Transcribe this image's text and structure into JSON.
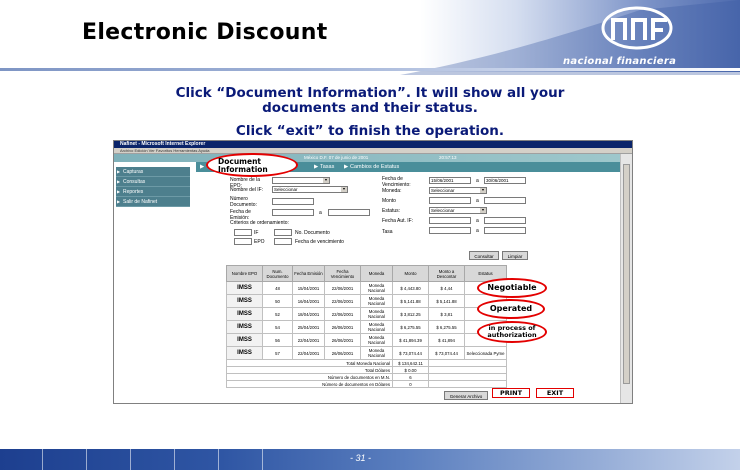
{
  "slide": {
    "title": "Electronic Discount",
    "logo_text": "nacional financiera",
    "instruction_1_line_1": "Click “Document Information”. It will show all your",
    "instruction_1_line_2": "documents and their status.",
    "instruction_2": "Click “exit” to finish the operation.",
    "page_number": "- 31 -"
  },
  "browser": {
    "window_title": "Nafinet - Microsoft Internet Explorer",
    "menu_bar": "Archivo  Edición  Ver  Favoritos  Herramientas  Ayuda",
    "header_date": "México D.F. 07 de junio de 2001",
    "header_time": "20:57:13",
    "nav_tab_tasas": "Tasas",
    "nav_tab_cambios": "Cambios de Estatus"
  },
  "left_menu": {
    "items": [
      "Capturas",
      "Consultas",
      "Reportes",
      "Salir de Nafinet"
    ]
  },
  "form": {
    "epo_label": "Nombre de la EPO:",
    "if_label": "Nombre del IF:",
    "if_value": "Seleccionar",
    "num_doc_label": "Número Documento:",
    "fecha_emision_label": "Fecha de Emisión:",
    "a_label": "a",
    "criterios_label": "Criterios de ordenamiento:",
    "if_sort_label": "IF",
    "num_doc_sort_label": "No. Documento",
    "epo_sort_label": "EPO",
    "fecha_venc_sort_label": "Fecha de vencimiento",
    "fecha_venc_label": "Fecha de Vencimiento:",
    "fecha_venc_from": "15/06/2001",
    "fecha_venc_to": "30/06/2001",
    "moneda_label": "Moneda:",
    "moneda_value": "Seleccionar",
    "monto_label": "Monto",
    "estatus_label": "Estatus:",
    "estatus_value": "Seleccionar",
    "fecha_aut_label": "Fecha Aut. IF:",
    "tasa_label": "Tasa",
    "consultar_label": "Consultar",
    "limpiar_label": "Limpiar"
  },
  "table": {
    "headers": [
      "Nombre EPO",
      "Num. Documento",
      "Fecha Emisión",
      "Fecha Vencimiento",
      "Moneda",
      "Monto",
      "Monto a Descontar",
      "Estatus"
    ],
    "rows": [
      {
        "epo": "IMSS",
        "num": "48",
        "emision": "15/04/2001",
        "venc": "22/06/2001",
        "moneda": "Moneda Nacional",
        "monto": "$ 4,443.80",
        "descontar": "$ 4,44",
        "estatus": ""
      },
      {
        "epo": "IMSS",
        "num": "50",
        "emision": "16/04/2001",
        "venc": "22/06/2001",
        "moneda": "Moneda Nacional",
        "monto": "$ 5,141.88",
        "descontar": "$ 5,141.88",
        "estatus": ""
      },
      {
        "epo": "IMSS",
        "num": "52",
        "emision": "18/04/2001",
        "venc": "22/06/2001",
        "moneda": "Moneda Nacional",
        "monto": "$ 3,812.25",
        "descontar": "$ 3,81",
        "estatus": ""
      },
      {
        "epo": "IMSS",
        "num": "54",
        "emision": "25/04/2001",
        "venc": "26/06/2001",
        "moneda": "Moneda Nacional",
        "monto": "$ 6,275.55",
        "descontar": "$ 6,275.55",
        "estatus": ""
      },
      {
        "epo": "IMSS",
        "num": "56",
        "emision": "22/04/2001",
        "venc": "26/06/2001",
        "moneda": "Moneda Nacional",
        "monto": "$ 41,894.39",
        "descontar": "$ 41,894",
        "estatus": ""
      },
      {
        "epo": "IMSS",
        "num": "57",
        "emision": "22/04/2001",
        "venc": "26/06/2001",
        "moneda": "Moneda Nacional",
        "monto": "$ 73,074.44",
        "descontar": "$ 73,074.44",
        "estatus": "Seleccionada Pyme"
      }
    ],
    "totals": [
      {
        "label": "Total Moneda Nacional",
        "value": "$ 134,642.11"
      },
      {
        "label": "Total Dólares",
        "value": "$ 0.00"
      },
      {
        "label": "Número de documentos en M.N.",
        "value": "6"
      },
      {
        "label": "Número de documentos en Dólares",
        "value": "0"
      }
    ]
  },
  "callouts": {
    "document_information": "Document Information",
    "negotiable": "Negotiable",
    "operated": "Operated",
    "in_process": "in process of authorization"
  },
  "buttons": {
    "generar": "Generar Archivo",
    "print": "PRINT",
    "exit": "EXIT"
  },
  "colors": {
    "instruction_text": "#0a1a78",
    "callout_border": "#e30000",
    "menu_bg": "#4d7f8d",
    "nav_bar": "#4a8e9a",
    "footer": "#2f56a4"
  }
}
